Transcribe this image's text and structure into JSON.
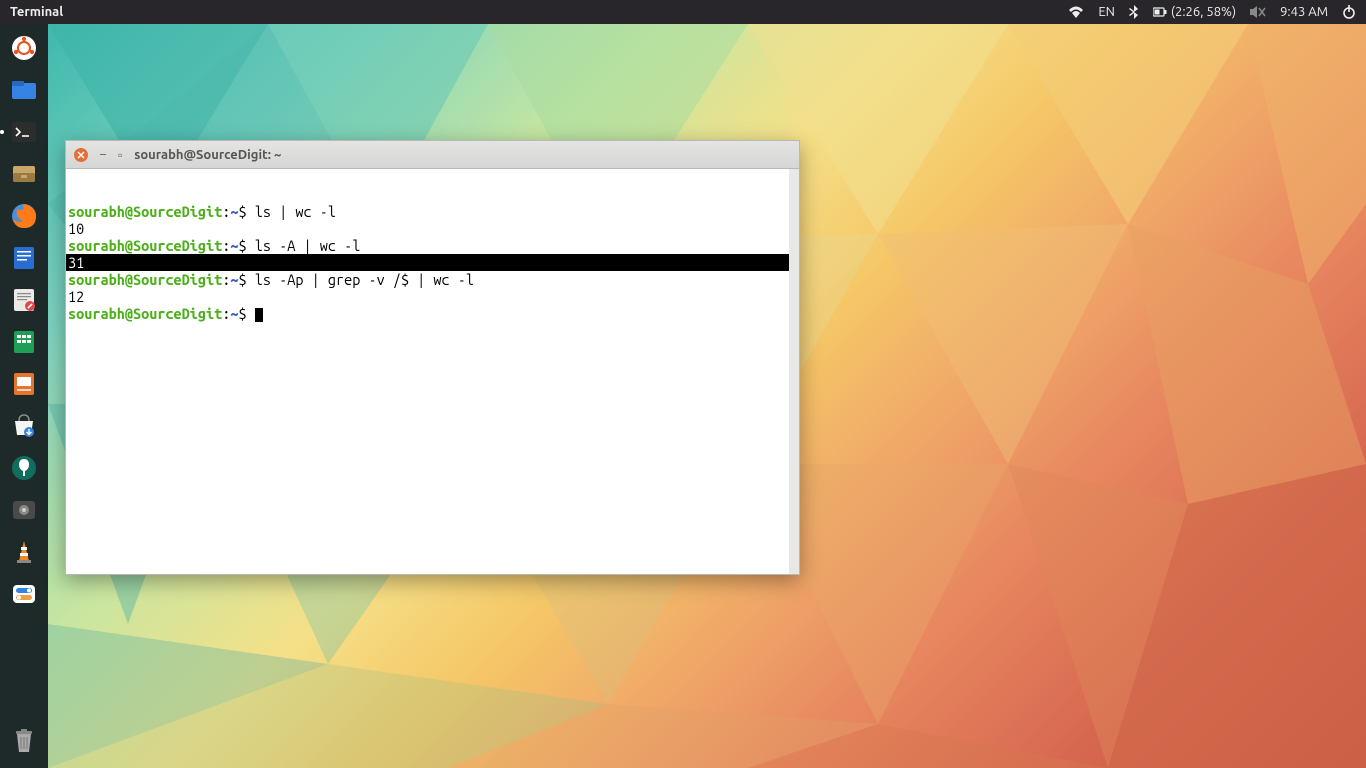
{
  "topbar": {
    "title": "Terminal",
    "language": "EN",
    "battery": "(2:26, 58%)",
    "time": "9:43 AM"
  },
  "dock": {
    "items": [
      {
        "name": "show-applications",
        "icon": "ubuntu"
      },
      {
        "name": "files",
        "icon": "folder"
      },
      {
        "name": "terminal",
        "icon": "terminal",
        "active": true
      },
      {
        "name": "file-manager",
        "icon": "drawer"
      },
      {
        "name": "firefox",
        "icon": "firefox"
      },
      {
        "name": "libreoffice-writer",
        "icon": "writer"
      },
      {
        "name": "text-editor",
        "icon": "note"
      },
      {
        "name": "libreoffice-calc",
        "icon": "calc"
      },
      {
        "name": "libreoffice-impress",
        "icon": "impress"
      },
      {
        "name": "software-center",
        "icon": "shop"
      },
      {
        "name": "settings",
        "icon": "wrench"
      },
      {
        "name": "image-viewer",
        "icon": "eye"
      },
      {
        "name": "vlc",
        "icon": "cone"
      },
      {
        "name": "system-monitor",
        "icon": "toggle"
      }
    ],
    "trash_label": "trash"
  },
  "window": {
    "title": "sourabh@SourceDigit: ~",
    "prompt_user": "sourabh@SourceDigit",
    "prompt_sep": ":",
    "prompt_path": "~",
    "prompt_symbol": "$",
    "lines": [
      {
        "type": "cmd",
        "text": "ls | wc -l"
      },
      {
        "type": "out",
        "text": "10"
      },
      {
        "type": "cmd",
        "text": "ls -A | wc -l"
      },
      {
        "type": "out-hl",
        "text": "31"
      },
      {
        "type": "cmd",
        "text": "ls -Ap | grep -v /$ | wc -l"
      },
      {
        "type": "out",
        "text": "12"
      },
      {
        "type": "cmd-cursor",
        "text": ""
      }
    ]
  }
}
